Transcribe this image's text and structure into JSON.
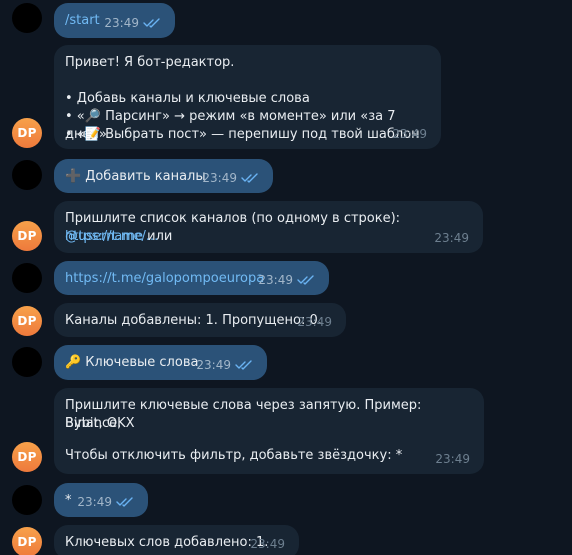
{
  "messages": [
    {
      "sender": "user",
      "text": "/start",
      "time": "23:49"
    },
    {
      "sender": "bot",
      "avatar": "DP",
      "lines": [
        "Привет! Я бот-редактор.",
        "",
        "• Добавь каналы и ключевые слова",
        "• «🔎 Парсинг» → режим «в моменте» или «за 7 дней»",
        "• «📝 Выбрать пост» — перепишу под твой шаблон"
      ],
      "time": "23:49"
    },
    {
      "sender": "user",
      "icon": "plus-icon",
      "icon_glyph": "➕",
      "text": "Добавить каналы",
      "time": "23:49"
    },
    {
      "sender": "bot",
      "avatar": "DP",
      "text_before": "Пришлите список каналов (по одному в строке): ",
      "username_link": "@username",
      "text_middle": " или",
      "url_link": "https://t.me/...",
      "time": "23:49"
    },
    {
      "sender": "user",
      "link": "https://t.me/galopompoeuropa",
      "time": "23:49"
    },
    {
      "sender": "bot",
      "avatar": "DP",
      "text": "Каналы добавлены: 1. Пропущено: 0.",
      "time": "23:49"
    },
    {
      "sender": "user",
      "icon": "key-icon",
      "icon_glyph": "🔑",
      "text": "Ключевые слова",
      "time": "23:49"
    },
    {
      "sender": "bot",
      "avatar": "DP",
      "lines": [
        "Пришлите ключевые слова через запятую. Пример: Binance,",
        "Bybit, OKX",
        "",
        "Чтобы отключить фильтр, добавьте звёздочку: *"
      ],
      "time": "23:49"
    },
    {
      "sender": "user",
      "text": "*",
      "time": "23:49"
    },
    {
      "sender": "bot",
      "avatar": "DP",
      "text": "Ключевых слов добавлено: 1.",
      "time": "23:49"
    }
  ],
  "colors": {
    "background": "#0e1621",
    "outgoing_bubble": "#2b5278",
    "incoming_bubble": "#182533",
    "link": "#71baf4",
    "ticks": "#6ab3f3",
    "bot_avatar": "#f0883e"
  }
}
